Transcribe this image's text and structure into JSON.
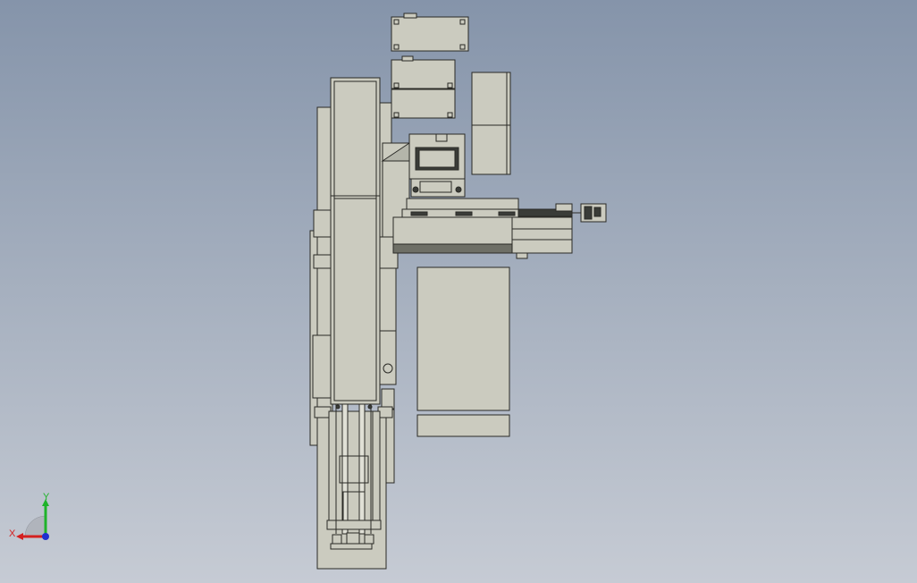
{
  "view": {
    "model_colors": {
      "face": "#cbcbbf",
      "face_dark": "#b4b5aa",
      "edge": "#2a2a26",
      "shadow": "#6e6f66",
      "inner_dark": "#3a3c38"
    },
    "triad": {
      "x_label": "X",
      "y_label": "Y",
      "x_color": "#d42020",
      "y_color": "#1fb32a",
      "z_color": "#2030d0"
    }
  }
}
